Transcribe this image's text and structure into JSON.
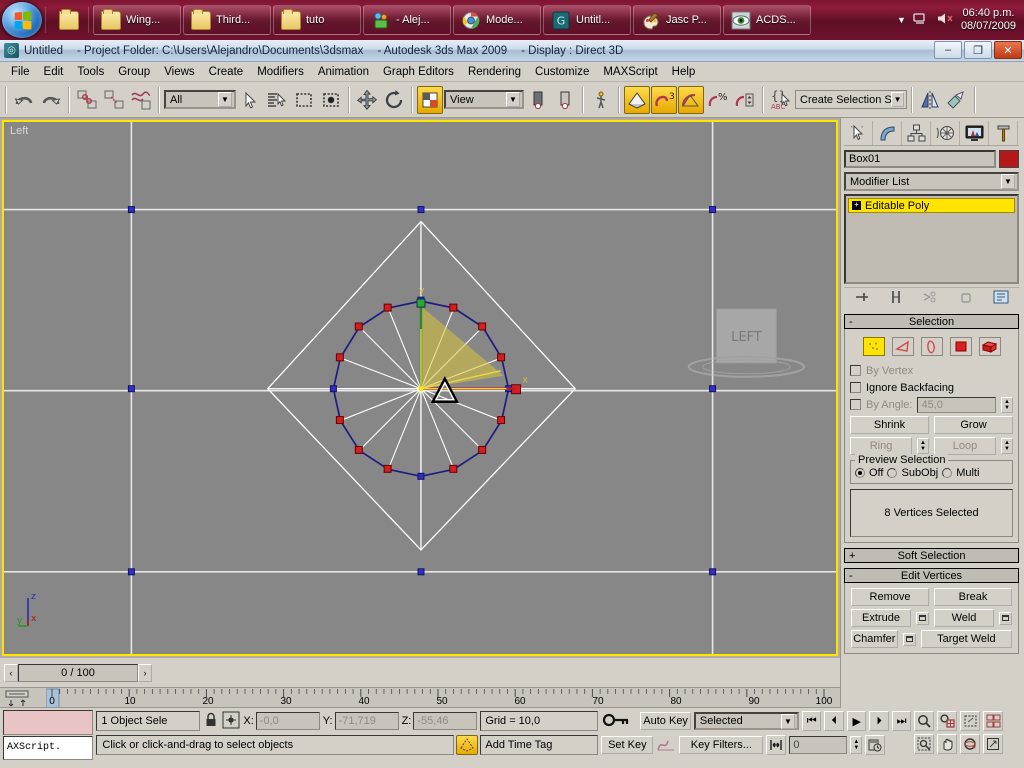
{
  "taskbar": {
    "start_name": "start-orb",
    "quicklaunch": [
      {
        "icon": "show-desktop-icon"
      }
    ],
    "buttons": [
      {
        "label": "Wing...",
        "icon": "folder-icon"
      },
      {
        "label": "Third...",
        "icon": "folder-icon"
      },
      {
        "label": "tuto",
        "icon": "folder-icon"
      },
      {
        "label": "- Alej...",
        "icon": "messenger-icon"
      },
      {
        "label": "Mode...",
        "icon": "browser-icon"
      },
      {
        "label": "Untitl...",
        "icon": "app-icon"
      },
      {
        "label": "Jasc P...",
        "icon": "paint-icon"
      },
      {
        "label": "ACDS...",
        "icon": "eye-icon"
      }
    ],
    "tray": {
      "overflow_icon": "chevron-up-icon",
      "network_icon": "network-icon",
      "volume_icon": "volume-muted-icon",
      "time": "06:40 p.m.",
      "date": "08/07/2009"
    }
  },
  "window": {
    "app_icon": "3dsmax-icon",
    "title_file": "Untitled",
    "title_project": "- Project Folder: C:\\Users\\Alejandro\\Documents\\3dsmax",
    "title_app": "- Autodesk 3ds Max  2009",
    "title_display": "- Display : Direct 3D",
    "minimize": "–",
    "maximize": "❐",
    "close": "✕"
  },
  "menubar": {
    "items": [
      "File",
      "Edit",
      "Tools",
      "Group",
      "Views",
      "Create",
      "Modifiers",
      "Animation",
      "Graph Editors",
      "Rendering",
      "Customize",
      "MAXScript",
      "Help"
    ]
  },
  "toolbar": {
    "undo": "undo-icon",
    "redo": "redo-icon",
    "select_link": "select-and-link-icon",
    "unlink": "unlink-selection-icon",
    "bind_space_warp": "bind-to-space-warp-icon",
    "filter_value": "All",
    "select_object": "select-object-icon",
    "select_by_name": "select-by-name-icon",
    "select_region": "rectangular-selection-region-icon",
    "window_crossing": "window-crossing-icon",
    "select_move": "select-and-move-icon",
    "select_rotate": "select-and-rotate-icon",
    "ref_coord_icon": "use-center-icon",
    "ref_coord_value": "View",
    "pivot_a": "use-pivot-point-center-icon",
    "pivot_b": "use-selection-center-icon",
    "manipulate": "select-and-manipulate-icon",
    "snap_toggle": "snaps-toggle-icon",
    "snap3d": "snap-3d-icon",
    "angle_snap": "angle-snap-toggle-icon",
    "percent_snap": "percent-snap-toggle-icon",
    "spinner_snap": "spinner-snap-toggle-icon",
    "named_sets": "named-selection-sets-icon",
    "selection_set_value": "Create Selection Set",
    "mirror": "mirror-icon",
    "align": "align-icon"
  },
  "viewport": {
    "label": "Left",
    "viewcube_face": "LEFT",
    "axis": {
      "x": "x",
      "y": "y",
      "z": "z"
    }
  },
  "timeslider": {
    "prev": "‹",
    "next": "›",
    "value": "0 / 100",
    "ruler_labels": [
      "0",
      "10",
      "20",
      "30",
      "40",
      "50",
      "60",
      "70",
      "80",
      "90",
      "100"
    ],
    "ruler_min": 0,
    "ruler_max": 100,
    "key_mode_icon": "track-bar-icon"
  },
  "command_panel": {
    "tabs": [
      {
        "name": "create-tab",
        "icon": "create-arrow-icon"
      },
      {
        "name": "modify-tab",
        "icon": "modify-bend-icon"
      },
      {
        "name": "hierarchy-tab",
        "icon": "hierarchy-icon"
      },
      {
        "name": "motion-tab",
        "icon": "motion-wheel-icon"
      },
      {
        "name": "display-tab",
        "icon": "display-monitor-icon"
      },
      {
        "name": "utilities-tab",
        "icon": "utilities-hammer-icon"
      }
    ],
    "object_name": "Box01",
    "object_color": "#b41818",
    "modifier_list_label": "Modifier List",
    "modifier_dropdown_icon": "chevron-down-icon",
    "stack": [
      {
        "label": "Editable Poly",
        "expander": "+"
      }
    ],
    "stack_tools": [
      {
        "name": "pin-stack-icon"
      },
      {
        "name": "show-end-result-icon"
      },
      {
        "name": "make-unique-icon"
      },
      {
        "name": "remove-modifier-icon"
      },
      {
        "name": "configure-modifier-sets-icon"
      }
    ],
    "selection": {
      "title": "Selection",
      "expander": "-",
      "sub_objects": [
        {
          "name": "vertex-sub-object",
          "active": true
        },
        {
          "name": "edge-sub-object",
          "active": false
        },
        {
          "name": "border-sub-object",
          "active": false
        },
        {
          "name": "polygon-sub-object",
          "active": false
        },
        {
          "name": "element-sub-object",
          "active": false
        }
      ],
      "by_vertex": "By Vertex",
      "ignore_backfacing": "Ignore Backfacing",
      "by_angle": "By Angle:",
      "by_angle_value": "45,0",
      "shrink": "Shrink",
      "grow": "Grow",
      "ring": "Ring",
      "loop": "Loop",
      "preview_legend": "Preview Selection",
      "preview_off": "Off",
      "preview_subobj": "SubObj",
      "preview_multi": "Multi",
      "status": "8 Vertices Selected"
    },
    "soft_selection": {
      "title": "Soft Selection",
      "expander": "+"
    },
    "edit_vertices": {
      "title": "Edit Vertices",
      "expander": "-",
      "remove": "Remove",
      "break": "Break",
      "extrude": "Extrude",
      "weld": "Weld",
      "chamfer": "Chamfer",
      "target_weld": "Target Weld"
    }
  },
  "statusbar": {
    "maxscript_label": "AXScript.",
    "selection_count": "1 Object Sele",
    "lock_icon": "lock-selection-icon",
    "coord_icon": "absolute-relative-icon",
    "x_label": "X:",
    "x_value": "-0,0",
    "y_label": "Y:",
    "y_value": "-71,719",
    "z_label": "Z:",
    "z_value": "-55,46",
    "grid": "Grid = 10,0",
    "add_time_tag": "Add Time Tag",
    "prompt": "Click or click-and-drag to select objects",
    "adaptive_degradation_icon": "adaptive-degradation-icon",
    "key_mode_icon": "key-mode-icon",
    "auto_key": "Auto Key",
    "set_key": "Set Key",
    "key_filter_set": "Selected",
    "key_filters": "Key Filters...",
    "curve_icon": "set-key-curve-icon",
    "frame_value": "0",
    "playback": [
      {
        "name": "goto-start-button",
        "glyph": "⏮"
      },
      {
        "name": "previous-frame-button",
        "glyph": "⏴"
      },
      {
        "name": "play-button",
        "glyph": "▶"
      },
      {
        "name": "next-frame-button",
        "glyph": "⏵"
      },
      {
        "name": "goto-end-button",
        "glyph": "⏭"
      }
    ],
    "key_step": "key-mode-toggle-icon",
    "time_config_icon": "time-configuration-icon",
    "nav": [
      {
        "name": "zoom-button",
        "icon": "magnifier-icon"
      },
      {
        "name": "zoom-all-button",
        "icon": "zoom-all-icon"
      },
      {
        "name": "zoom-extents-button",
        "icon": "zoom-extents-icon"
      },
      {
        "name": "zoom-extents-all-button",
        "icon": "zoom-extents-all-icon"
      },
      {
        "name": "field-of-view-button",
        "icon": "region-zoom-icon"
      },
      {
        "name": "pan-button",
        "icon": "hand-icon"
      },
      {
        "name": "arc-rotate-button",
        "icon": "arc-rotate-icon"
      },
      {
        "name": "maximize-viewport-button",
        "icon": "maximize-viewport-icon"
      }
    ]
  }
}
